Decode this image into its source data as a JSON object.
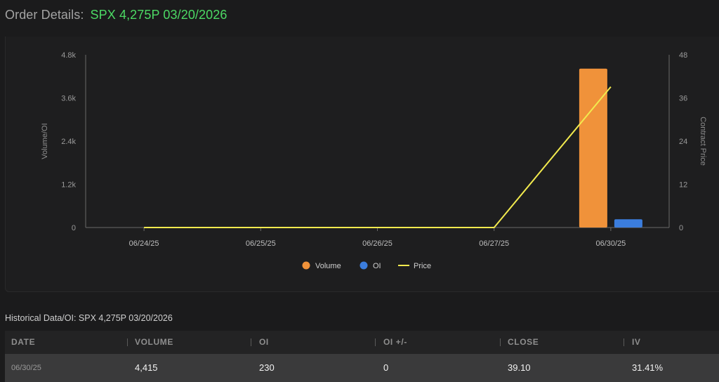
{
  "header": {
    "label": "Order Details:",
    "symbol": "SPX 4,275P 03/20/2026"
  },
  "chart_data": {
    "type": "bar",
    "categories": [
      "06/24/25",
      "06/25/25",
      "06/26/25",
      "06/27/25",
      "06/30/25"
    ],
    "series": [
      {
        "name": "Volume",
        "type": "bar",
        "axis": "left",
        "color": "#f0923a",
        "values": [
          0,
          0,
          0,
          0,
          4415
        ]
      },
      {
        "name": "OI",
        "type": "bar",
        "axis": "left",
        "color": "#3b7ddd",
        "values": [
          0,
          0,
          0,
          0,
          230
        ]
      },
      {
        "name": "Price",
        "type": "line",
        "axis": "right",
        "color": "#f2ea4e",
        "values": [
          0,
          0,
          0,
          0,
          39.1
        ]
      }
    ],
    "ylabel": "Volume/OI",
    "y2label": "Contract Price",
    "ylim": [
      0,
      4800
    ],
    "y2lim": [
      0,
      48
    ],
    "yticks": [
      "0",
      "1.2k",
      "2.4k",
      "3.6k",
      "4.8k"
    ],
    "y2ticks": [
      "0",
      "12",
      "24",
      "36",
      "48"
    ],
    "legend_position": "bottom-center",
    "grid": false
  },
  "historical": {
    "title": "Historical Data/OI: SPX 4,275P 03/20/2026",
    "columns": [
      "DATE",
      "VOLUME",
      "OI",
      "OI +/-",
      "CLOSE",
      "IV"
    ],
    "rows": [
      {
        "date": "06/30/25",
        "volume": "4,415",
        "oi": "230",
        "oi_change": "0",
        "close": "39.10",
        "iv": "31.41%"
      }
    ]
  },
  "colors": {
    "background": "#1b1b1c",
    "accent_green": "#4cd964",
    "volume": "#f0923a",
    "oi": "#3b7ddd",
    "price": "#f2ea4e"
  }
}
